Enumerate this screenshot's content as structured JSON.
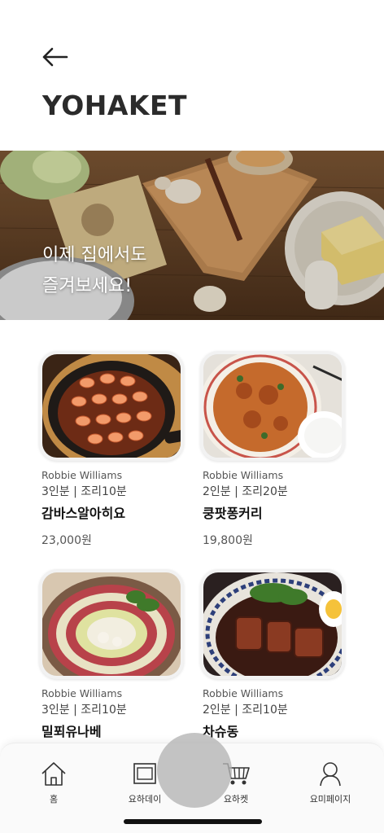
{
  "header": {
    "back_icon": "arrow-left-icon",
    "brand": "YOHAKET"
  },
  "banner": {
    "line1": "이제 집에서도",
    "line2": "즐겨보세요!"
  },
  "products": [
    {
      "author": "Robbie Williams",
      "meta": "3인분 | 조리10분",
      "name": "감바스알아히요",
      "price": "23,000원"
    },
    {
      "author": "Robbie Williams",
      "meta": "2인분 | 조리20분",
      "name": "쿵팟퐁커리",
      "price": "19,800원"
    },
    {
      "author": "Robbie Williams",
      "meta": "3인분 | 조리10분",
      "name": "밀푀유나베",
      "price": ""
    },
    {
      "author": "Robbie Williams",
      "meta": "2인분 | 조리10분",
      "name": "차슈동",
      "price": ""
    }
  ],
  "tabbar": {
    "items": [
      {
        "label": "홈",
        "icon": "home-icon"
      },
      {
        "label": "요하데이",
        "icon": "calendar-icon"
      },
      {
        "label": "요하켓",
        "icon": "cart-icon"
      },
      {
        "label": "요미페이지",
        "icon": "user-icon"
      }
    ]
  },
  "colors": {
    "text": "#222222",
    "background": "#ffffff",
    "tabbar": "#fafafa"
  }
}
